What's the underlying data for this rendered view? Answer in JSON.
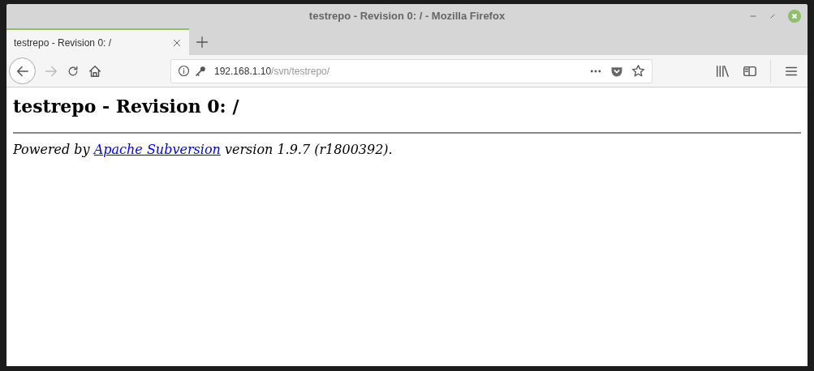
{
  "window": {
    "title": "testrepo - Revision 0: / - Mozilla Firefox"
  },
  "tabs": [
    {
      "label": "testrepo - Revision 0: /",
      "selected": true
    }
  ],
  "address_bar": {
    "host": "192.168.1.10",
    "path": "/svn/testrepo/"
  },
  "page": {
    "heading": "testrepo - Revision 0: /",
    "footer": {
      "before": "Powered by ",
      "link": "Apache Subversion",
      "after": " version 1.9.7 (r1800392)."
    }
  }
}
